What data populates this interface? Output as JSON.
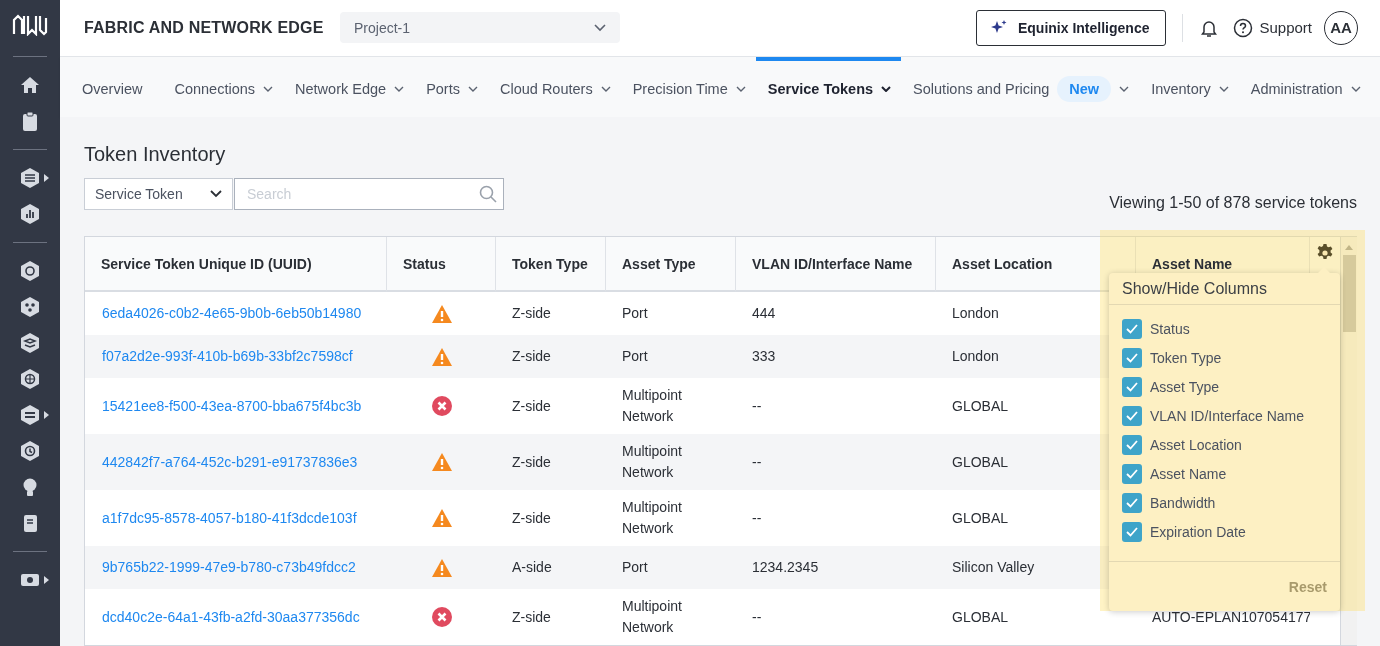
{
  "header": {
    "title": "FABRIC AND NETWORK EDGE",
    "project": "Project-1",
    "ai_button": "Equinix Intelligence",
    "support": "Support",
    "avatar": "AA"
  },
  "nav": [
    {
      "label": "Overview",
      "selected": false,
      "menu": false
    },
    {
      "label": "Connections",
      "selected": false,
      "menu": true
    },
    {
      "label": "Network Edge",
      "selected": false,
      "menu": true
    },
    {
      "label": "Ports",
      "selected": false,
      "menu": true
    },
    {
      "label": "Cloud Routers",
      "selected": false,
      "menu": true
    },
    {
      "label": "Precision Time",
      "selected": false,
      "menu": true
    },
    {
      "label": "Service Tokens",
      "selected": true,
      "menu": true
    },
    {
      "label": "Solutions and Pricing",
      "selected": false,
      "menu": true,
      "badge": "New"
    },
    {
      "label": "Inventory",
      "selected": false,
      "menu": true
    },
    {
      "label": "Administration",
      "selected": false,
      "menu": true
    }
  ],
  "page": {
    "title": "Token Inventory",
    "filter": "Service Token",
    "search": {
      "placeholder": "Search"
    },
    "count": "Viewing 1-50 of 878 service tokens"
  },
  "table": {
    "columns": [
      "Service Token Unique ID (UUID)",
      "Status",
      "Token Type",
      "Asset Type",
      "VLAN ID/Interface Name",
      "Asset Location",
      "Asset Name"
    ],
    "rows": [
      {
        "uuid": "6eda4026-c0b2-4e65-9b0b-6eb50b14980",
        "kind": "warning",
        "token_type": "Z-side",
        "asset_type": "Port",
        "vlan": "444",
        "location": "London"
      },
      {
        "uuid": "f07a2d2e-993f-410b-b69b-33bf2c7598cf",
        "kind": "warning",
        "token_type": "Z-side",
        "asset_type": "Port",
        "vlan": "333",
        "location": "London"
      },
      {
        "uuid": "15421ee8-f500-43ea-8700-bba675f4bc3b",
        "kind": "error",
        "token_type": "Z-side",
        "asset_type": "Multipoint Network",
        "vlan": "--",
        "location": "GLOBAL"
      },
      {
        "uuid": "442842f7-a764-452c-b291-e91737836e3",
        "kind": "warning",
        "token_type": "Z-side",
        "asset_type": "Multipoint Network",
        "vlan": "--",
        "location": "GLOBAL"
      },
      {
        "uuid": "a1f7dc95-8578-4057-b180-41f3dcde103f",
        "kind": "warning",
        "token_type": "Z-side",
        "asset_type": "Multipoint Network",
        "vlan": "--",
        "location": "GLOBAL"
      },
      {
        "uuid": "9b765b22-1999-47e9-b780-c73b49fdcc2",
        "kind": "warning",
        "token_type": "A-side",
        "asset_type": "Port",
        "vlan": "1234.2345",
        "location": "Silicon Valley"
      },
      {
        "uuid": "dcd40c2e-64a1-43fb-a2fd-30aa377356dc",
        "kind": "error",
        "token_type": "Z-side",
        "asset_type": "Multipoint Network",
        "vlan": "--",
        "location": "GLOBAL",
        "asset_name": "AUTO-EPLAN107054177"
      }
    ]
  },
  "column_menu": {
    "title": "Show/Hide Columns",
    "items": [
      {
        "label": "Status",
        "checked": true
      },
      {
        "label": "Token Type",
        "checked": true
      },
      {
        "label": "Asset Type",
        "checked": true
      },
      {
        "label": "VLAN ID/Interface Name",
        "checked": true
      },
      {
        "label": "Asset Location",
        "checked": true
      },
      {
        "label": "Asset Name",
        "checked": true
      },
      {
        "label": "Bandwidth",
        "checked": true
      },
      {
        "label": "Expiration Date",
        "checked": true
      }
    ],
    "reset": {
      "label": "Reset",
      "disabled": true
    }
  }
}
